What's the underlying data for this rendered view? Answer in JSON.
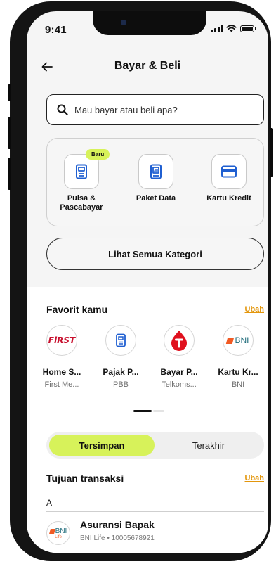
{
  "status_bar": {
    "time": "9:41"
  },
  "header": {
    "title": "Bayar & Beli"
  },
  "search": {
    "placeholder": "Mau bayar atau beli apa?"
  },
  "categories": [
    {
      "label_line1": "Pulsa &",
      "label_line2": "Pascabayar",
      "icon": "phone-card-icon",
      "badge": "Baru"
    },
    {
      "label_line1": "Paket Data",
      "label_line2": "",
      "icon": "data-chart-icon"
    },
    {
      "label_line1": "Kartu Kredit",
      "label_line2": "",
      "icon": "credit-card-icon"
    }
  ],
  "see_all_label": "Lihat Semua Kategori",
  "favorites": {
    "title": "Favorit kamu",
    "edit_label": "Ubah",
    "items": [
      {
        "name": "Home S...",
        "sub": "First Me...",
        "logo_text": "FiRST",
        "icon": "first-media-logo"
      },
      {
        "name": "Pajak P...",
        "sub": "PBB",
        "icon": "tax-document-icon"
      },
      {
        "name": "Bayar P...",
        "sub": "Telkoms...",
        "icon": "telkomsel-logo"
      },
      {
        "name": "Kartu Kr...",
        "sub": "BNI",
        "logo_text": "BNI",
        "icon": "bni-logo"
      }
    ]
  },
  "tabs": {
    "saved": "Tersimpan",
    "recent": "Terakhir",
    "active": "saved"
  },
  "destinations": {
    "title": "Tujuan transaksi",
    "edit_label": "Ubah",
    "group_letter": "A",
    "items": [
      {
        "title": "Asuransi Bapak",
        "sub": "BNI Life • 10005678921",
        "logo_text": "BNI",
        "logo_sub": "Life"
      }
    ]
  },
  "colors": {
    "accent": "#D7F25A",
    "link": "#E3960C",
    "telkomsel": "#E0111E",
    "bni_orange": "#F15A23",
    "bni_teal": "#1E6B7A"
  }
}
